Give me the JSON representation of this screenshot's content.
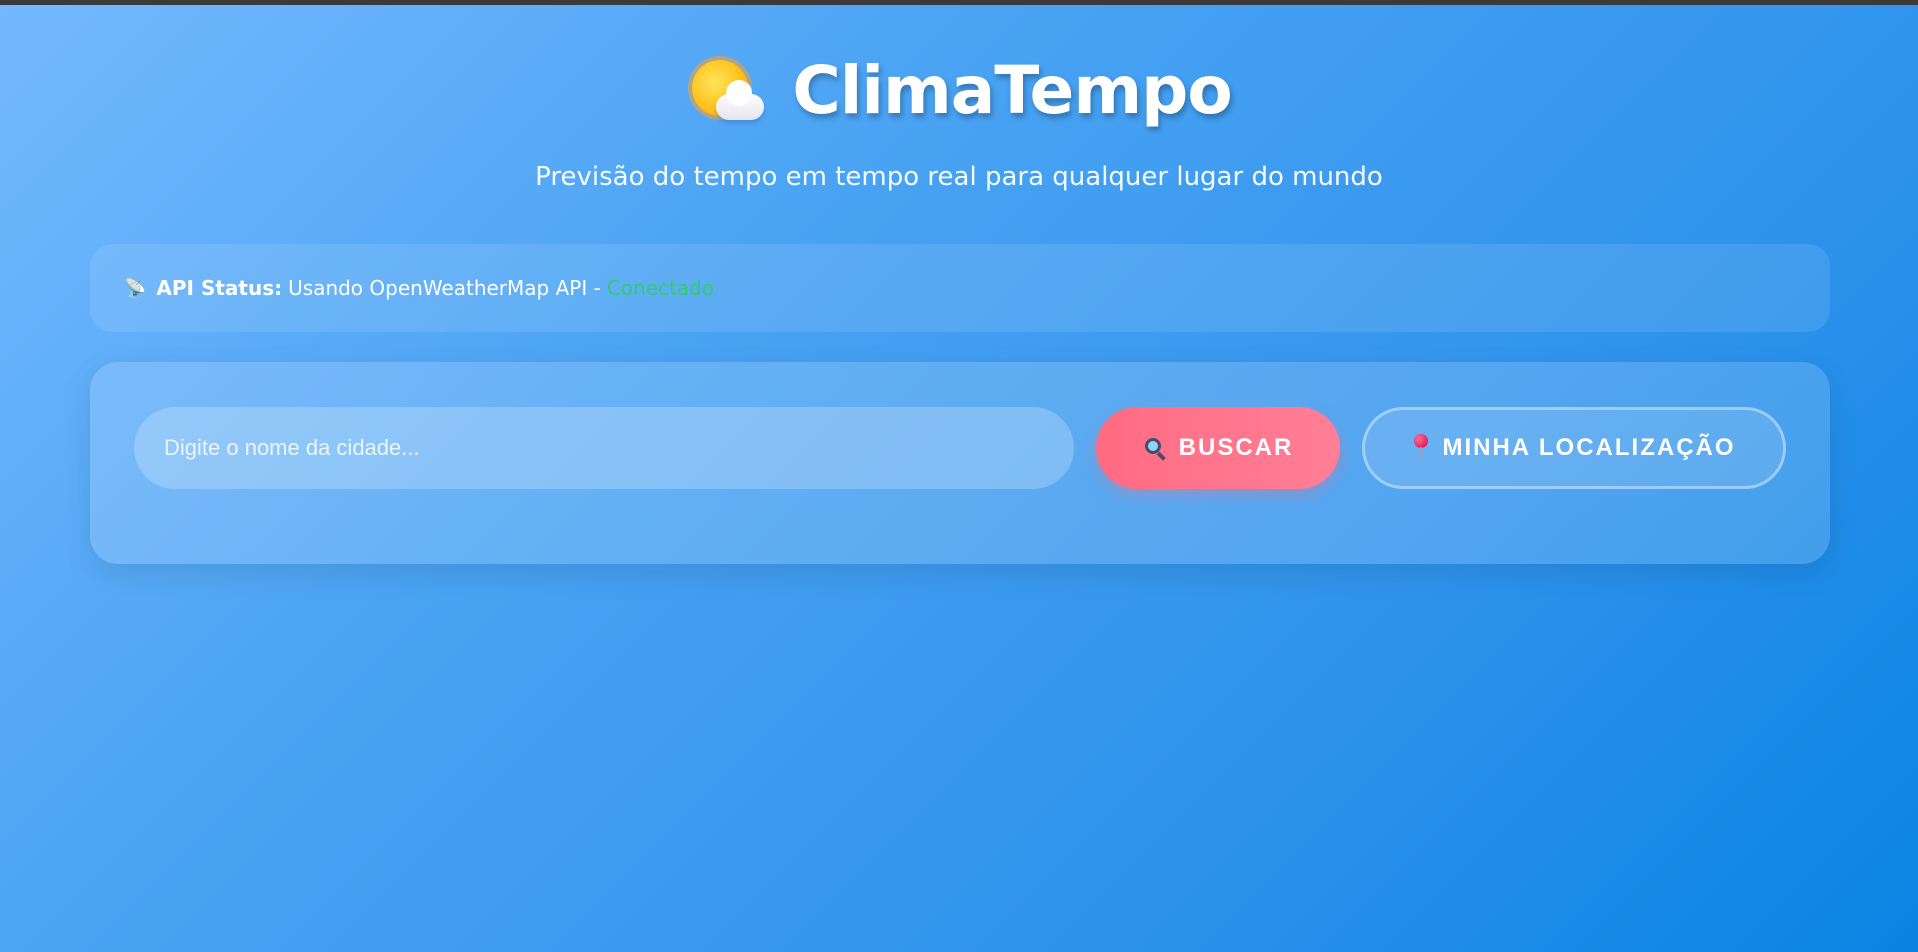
{
  "header": {
    "icon": "sun-behind-cloud-icon",
    "title": "ClimaTempo",
    "subtitle": "Previsão do tempo em tempo real para qualquer lugar do mundo"
  },
  "api_status": {
    "icon": "satellite-antenna-icon",
    "label": "API Status:",
    "text": "Usando OpenWeatherMap API -",
    "state": "Conectado",
    "state_color": "#2ecc71"
  },
  "search": {
    "placeholder": "Digite o nome da cidade...",
    "value": "",
    "search_button_icon": "magnifying-glass-icon",
    "search_button_label": "BUSCAR",
    "search_button_color": "#ff6b81",
    "location_button_icon": "round-pushpin-icon",
    "location_button_label": "MINHA LOCALIZAÇÃO"
  },
  "theme": {
    "background_start": "#74b9ff",
    "background_end": "#0984e3"
  }
}
